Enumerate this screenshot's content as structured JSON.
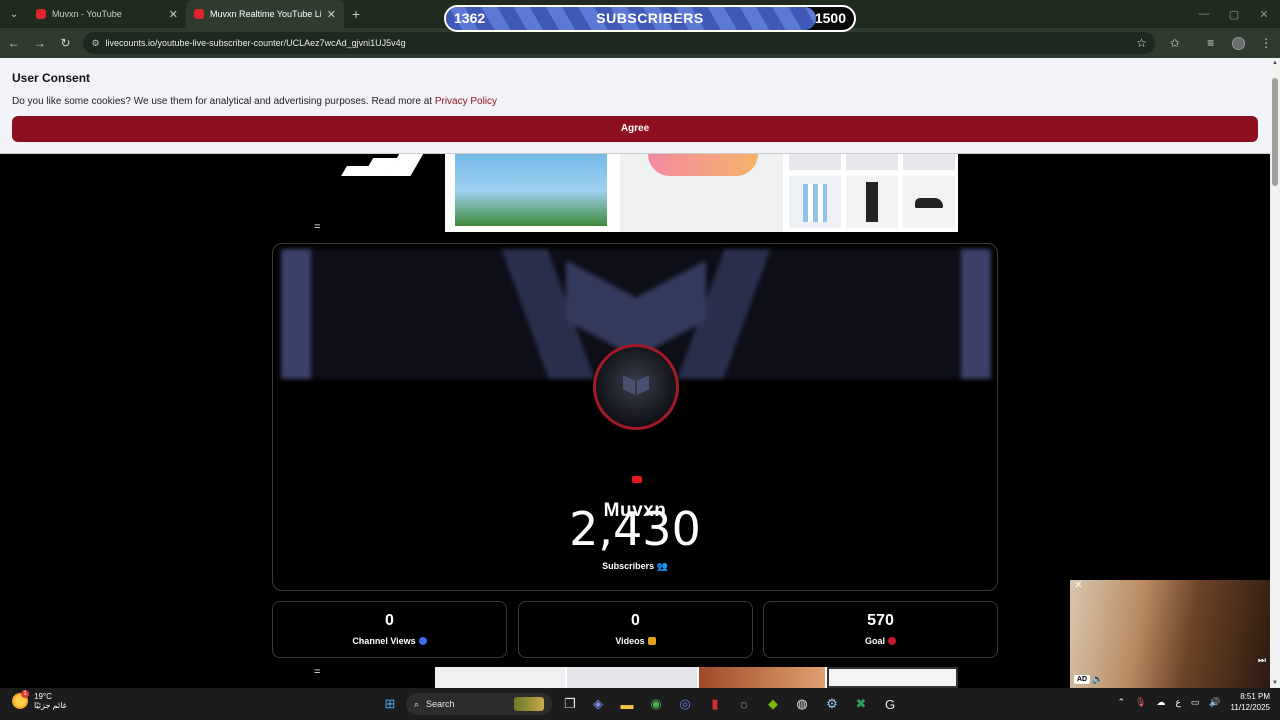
{
  "browser": {
    "tabs": [
      {
        "label": "Muvxn - YouTube",
        "active": false
      },
      {
        "label": "Muvxn Realtime YouTube Live S",
        "active": true
      }
    ],
    "url": "livecounts.io/youtube-live-subscriber-counter/UCLAez7wcAd_gjvni1UJ5v4g",
    "new_tab": "+"
  },
  "overlay_bar": {
    "current": "1362",
    "label": "SUBSCRIBERS",
    "target": "1500",
    "progress": 0.908
  },
  "consent": {
    "title": "User Consent",
    "message": "Do you like some cookies? We use them for analytical and advertising purposes. Read more at ",
    "link": "Privacy Policy",
    "agree": "Agree"
  },
  "channel": {
    "name": "Muvxn",
    "subscriber_count": "2,430",
    "subscribers_label": "Subscribers"
  },
  "stats": [
    {
      "value": "0",
      "label": "Channel Views",
      "dot_color": "#3a6cf0"
    },
    {
      "value": "0",
      "label": "Videos",
      "dot_color": "#e0a020"
    },
    {
      "value": "570",
      "label": "Goal",
      "dot_color": "#c8182a"
    }
  ],
  "ads": {
    "video_badge": "AD",
    "separator": "="
  },
  "taskbar": {
    "weather_temp": "19°C",
    "weather_text": "غائم جزئيًا",
    "weather_badge": "1",
    "search_label": "Search",
    "lang": "ع",
    "time": "8:51 PM",
    "date": "11/12/2025"
  },
  "colors": {
    "accent": "#8e0f1f",
    "bar_fill": "#4e6ac8"
  }
}
